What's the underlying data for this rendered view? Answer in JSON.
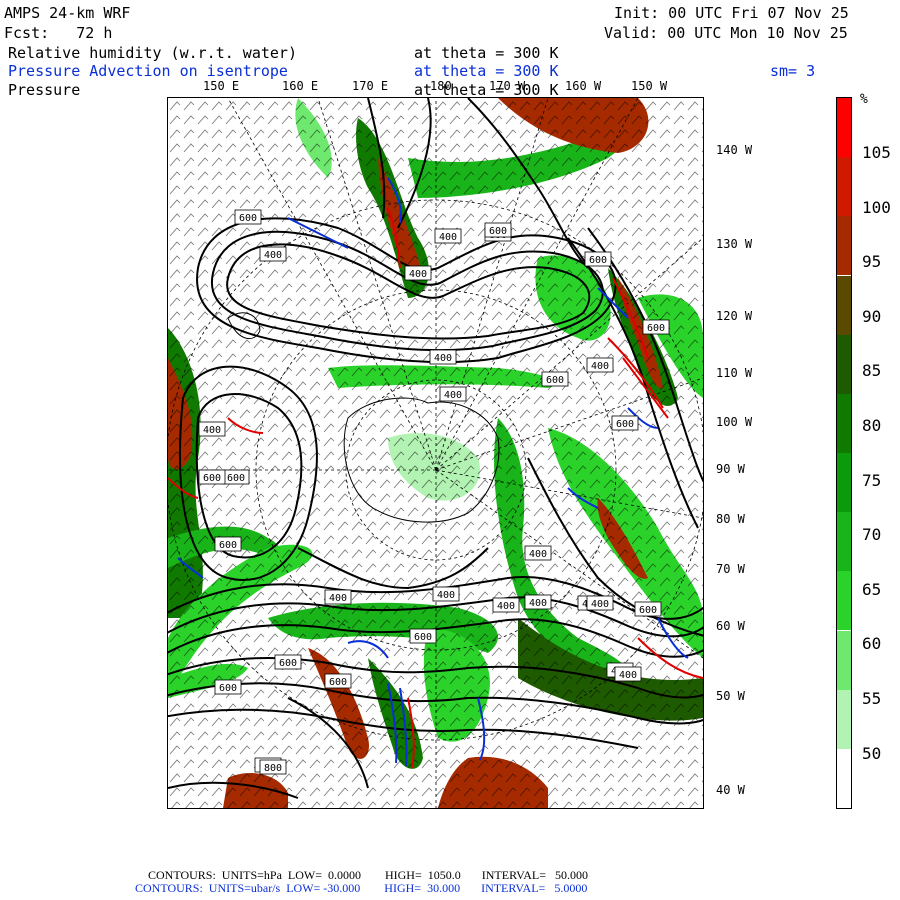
{
  "header": {
    "model": "AMPS 24-km WRF",
    "init": "Init: 00 UTC Fri 07 Nov 25",
    "fcst_label": "Fcst:",
    "fcst_hours": "72 h",
    "valid": "Valid: 00 UTC Mon 10 Nov 25",
    "field1": "Relative humidity (w.r.t. water)",
    "field1_level": "at theta = 300 K",
    "field2": "Pressure Advection on isentrope",
    "field2_level": "at theta = 300 K",
    "field2_smooth": "sm= 3",
    "field3": "Pressure",
    "field3_level": "at theta = 300 K"
  },
  "lon_labels_top": [
    "150 E",
    "160 E",
    "170 E",
    "180",
    "170 W",
    "160 W",
    "150 W"
  ],
  "lat_labels_right": [
    "140 W",
    "130 W",
    "120 W",
    "110 W",
    "100 W",
    "90 W",
    "80 W",
    "70 W",
    "60 W",
    "50 W",
    "40 W"
  ],
  "colorbar": {
    "unit": "%",
    "labels": [
      "105",
      "100",
      "95",
      "90",
      "85",
      "80",
      "75",
      "70",
      "65",
      "60",
      "55",
      "50"
    ],
    "colors": [
      "#ff0000",
      "#d01a00",
      "#a52a00",
      "#5a4a00",
      "#1e5a00",
      "#107a00",
      "#0a9a0a",
      "#19b419",
      "#2ad22a",
      "#6ee86e",
      "#b2f2b2",
      "#ffffff"
    ]
  },
  "pressure_labels": [
    "600",
    "400",
    "400",
    "400",
    "600",
    "600",
    "600",
    "400",
    "600",
    "600",
    "400",
    "400",
    "400",
    "400",
    "600",
    "400",
    "400",
    "400",
    "400",
    "600",
    "600",
    "600",
    "400",
    "400",
    "600",
    "600",
    "600",
    "400",
    "600",
    "800",
    "400",
    "600",
    "600"
  ],
  "footer": {
    "line1": "CONTOURS:  UNITS=hPa  LOW=  0.0000        HIGH=  1050.0       INTERVAL=   50.000",
    "line2": "CONTOURS:  UNITS=ubar/s  LOW= -30.000        HIGH=  30.000       INTERVAL=   5.0000"
  },
  "colors": {
    "text": "#000000",
    "advection": "#0a2fd6"
  }
}
